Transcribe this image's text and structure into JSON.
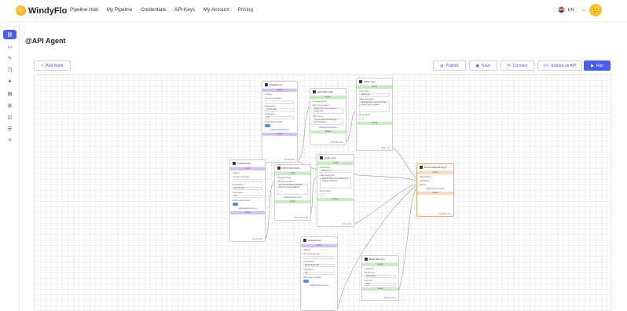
{
  "app": {
    "name": "WindyFlo"
  },
  "nav": [
    "Pipeline Hub",
    "My Pipeline",
    "Credentials",
    "API Keys",
    "My Account",
    "Pricing"
  ],
  "lang": "EN",
  "page": {
    "title": "@API Agent"
  },
  "toolbar": {
    "add_nodes": "Add Node",
    "publish": "Publish",
    "save": "Save",
    "connect": "Connect",
    "embed": "Embed as API",
    "run": "Run"
  },
  "nodes": {
    "chat_top": {
      "title": "ChatOpenAI",
      "band": "Inputs",
      "f1": "Caching",
      "f2": "Connect Credential",
      "f3": "Model Name",
      "v3": "gpt-3.5-turbo",
      "f4": "Temperature",
      "v4": "0.9",
      "f5": "Allow Image Uploads",
      "link": "Additional Parameters",
      "band2": "Output",
      "foot": "ChatOpenAI"
    },
    "chat_left": {
      "title": "ChatOpenAI",
      "band": "Inputs",
      "f1": "Caching",
      "f2": "Connect Credential",
      "f3": "Model Name",
      "v3": "gpt-3.5-turbo",
      "f4": "Temperature",
      "v4": "0.9",
      "f5": "Allow Image Uploads",
      "link": "Additional Parameters",
      "band2": "Output",
      "foot": "ChatOpenAI"
    },
    "chat_bottom": {
      "title": "ChatOpenAI",
      "band": "Inputs",
      "f1": "Caching",
      "f2": "Connect Credential",
      "f3": "Model Name",
      "v3": "gpt-3.5-turbo-16k",
      "f4": "Temperature",
      "v4": "0.9",
      "f5": "Allow Image Uploads",
      "link": "Additional Parameters"
    },
    "get_api": {
      "title": "GET API Chain",
      "band": "Inputs",
      "f1": "Language Model",
      "f2": "API Documentation",
      "v2": "BASE URL: https://api.open-meteo.com/",
      "f3": "URL Prompt",
      "v3": "You are given the below API Documentation:",
      "link": "Additional Parameters",
      "band2": "Output",
      "foot": "GET API Chain"
    },
    "post_api": {
      "title": "POST API Chain",
      "band": "Inputs",
      "f1": "Language Model",
      "f2": "API Documentation",
      "v2": "API documentation: Endpoint: https://eog.kindly.ai/api/v1/",
      "link": "Additional Parameters",
      "band2": "Output",
      "foot": "POST API Chain"
    },
    "chain_tool_1": {
      "title": "Chain Tool",
      "band": "Inputs",
      "f1": "Chain Name",
      "v1": "weather-qa",
      "f2": "Chain Description",
      "v2": "useful for when you need to ask question about weather",
      "f3": "Return Direct",
      "band2": "Output",
      "foot": "Chain Tool"
    },
    "chain_tool_2": {
      "title": "Chain Tool",
      "band": "Inputs",
      "f1": "Chain Name",
      "v1": "discord-bot",
      "f2": "Chain Description",
      "v2": "useful for when you need to send message to Discord",
      "f3": "Return Direct",
      "band2": "Output",
      "foot": "Chain Tool"
    },
    "agent": {
      "title": "Conversational Agent",
      "band": "Inputs",
      "f1": "Allowed Tools",
      "f2": "Chat Model",
      "f3": "Memory",
      "link": "Additional Parameters",
      "band2": "Output",
      "foot": "AgentExecutor"
    },
    "buffer": {
      "title": "Buffer Memory",
      "band": "Inputs",
      "f1": "Session Id",
      "v1": "",
      "f2": "Memory Key",
      "v2": "chat_history",
      "f3": "Input Key",
      "v3": "input",
      "band2": "Output",
      "foot": "BufferMemory"
    }
  }
}
